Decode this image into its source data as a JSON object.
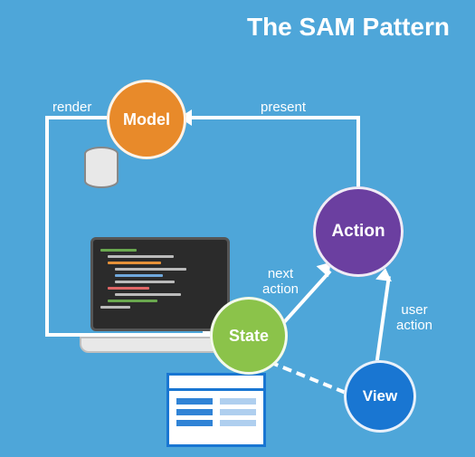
{
  "title": "The SAM Pattern",
  "nodes": {
    "model": {
      "label": "Model",
      "color": "#e88a2a"
    },
    "action": {
      "label": "Action",
      "color": "#6b3fa0"
    },
    "state": {
      "label": "State",
      "color": "#8bc34a"
    },
    "view": {
      "label": "View",
      "color": "#1976d2"
    }
  },
  "edges": {
    "present": {
      "label": "present",
      "from": "action",
      "to": "model",
      "style": "solid"
    },
    "render": {
      "label": "render",
      "from": "model",
      "to": "state",
      "style": "solid"
    },
    "next_action": {
      "label": "next\naction",
      "from": "state",
      "to": "action",
      "style": "solid"
    },
    "user_action": {
      "label": "user\naction",
      "from": "view",
      "to": "action",
      "style": "solid"
    },
    "state_view": {
      "label": "",
      "from": "state",
      "to": "view",
      "style": "dashed"
    }
  },
  "icons": {
    "database": "database-icon",
    "laptop": "laptop-code-icon",
    "document": "document-window-icon"
  },
  "colors": {
    "background": "#4ea6d9",
    "arrow": "#ffffff"
  }
}
